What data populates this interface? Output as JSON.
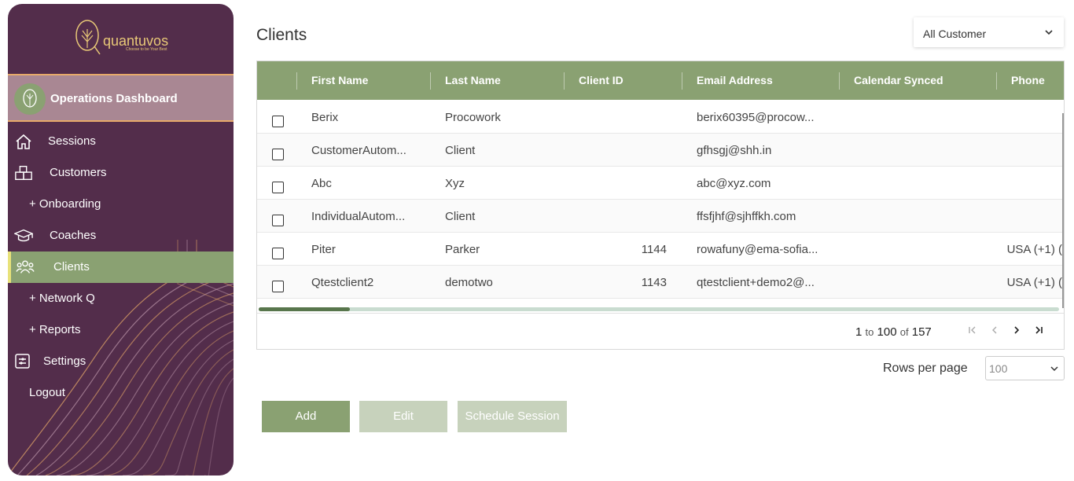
{
  "brand": {
    "name": "quantuvos",
    "tagline": "Choose to be Your Best"
  },
  "sidebar": {
    "dashboard_label": "Operations Dashboard",
    "items": [
      {
        "label": "Sessions",
        "icon": "home-icon"
      },
      {
        "label": "Customers",
        "icon": "boxes-icon"
      },
      {
        "label": "+ Onboarding"
      },
      {
        "label": "Coaches",
        "icon": "graduation-cap-icon"
      },
      {
        "label": "Clients",
        "icon": "users-icon",
        "active": true
      },
      {
        "label": "+ Network Q"
      },
      {
        "label": "+ Reports"
      },
      {
        "label": "Settings",
        "icon": "settings-list-icon"
      },
      {
        "label": "Logout"
      }
    ]
  },
  "page": {
    "title": "Clients"
  },
  "filter": {
    "selected": "All Customer"
  },
  "table": {
    "columns": [
      "First Name",
      "Last Name",
      "Client ID",
      "Email Address",
      "Calendar Synced",
      "Phone"
    ],
    "rows": [
      {
        "first": "Berix",
        "last": "Procowork",
        "id": "",
        "email": "berix60395@procow...",
        "synced": "",
        "phone": ""
      },
      {
        "first": "CustomerAutom...",
        "last": "Client",
        "id": "",
        "email": "gfhsgj@shh.in",
        "synced": "",
        "phone": ""
      },
      {
        "first": "Abc",
        "last": "Xyz",
        "id": "",
        "email": "abc@xyz.com",
        "synced": "",
        "phone": ""
      },
      {
        "first": "IndividualAutom...",
        "last": "Client",
        "id": "",
        "email": "ffsfjhf@sjhffkh.com",
        "synced": "",
        "phone": ""
      },
      {
        "first": "Piter",
        "last": "Parker",
        "id": "1144",
        "email": "rowafuny@ema-sofia...",
        "synced": "",
        "phone": "USA (+1) ("
      },
      {
        "first": "Qtestclient2",
        "last": "demotwo",
        "id": "1143",
        "email": "qtestclient+demo2@...",
        "synced": "",
        "phone": "USA (+1) ("
      }
    ]
  },
  "pagination": {
    "from": "1",
    "to_word": "to",
    "to": "100",
    "of_word": "of",
    "total": "157"
  },
  "rows_per_page": {
    "label": "Rows per page",
    "value": "100"
  },
  "actions": {
    "add": "Add",
    "edit": "Edit",
    "schedule": "Schedule Session"
  },
  "colors": {
    "sidebar": "#532d4b",
    "accent": "#8aa172",
    "disabled": "#c7d2bc",
    "gold": "#e8c877"
  }
}
